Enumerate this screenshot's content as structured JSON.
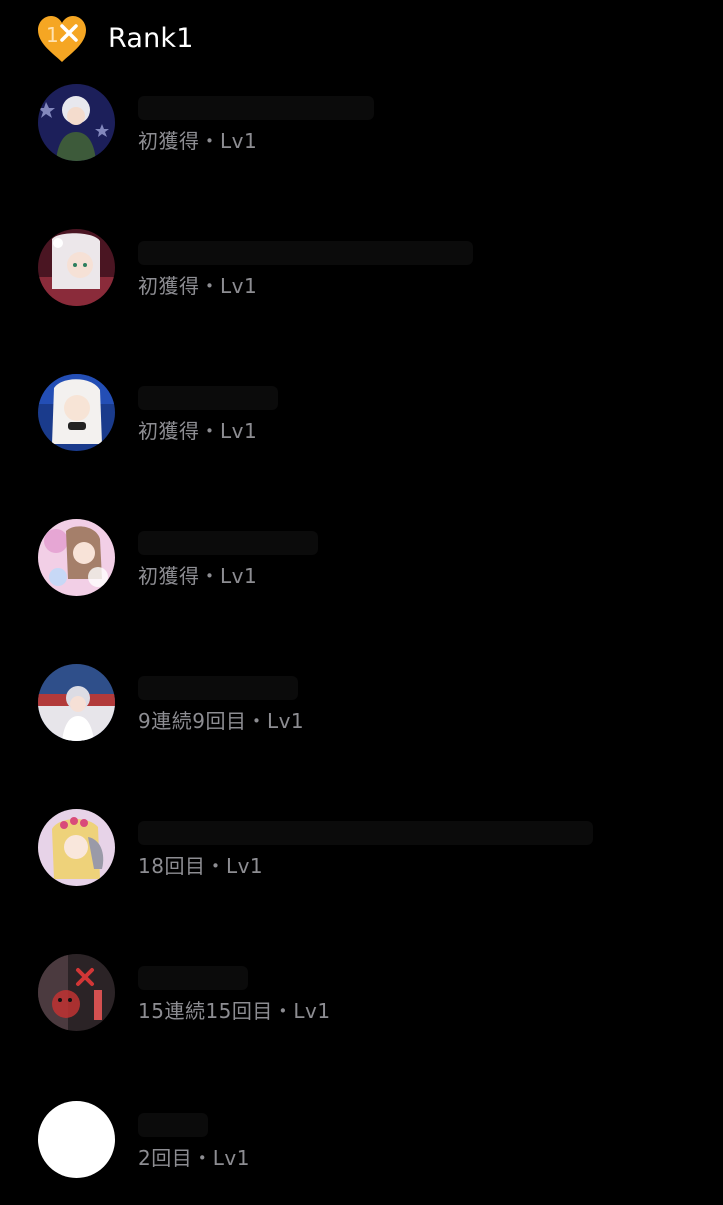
{
  "header": {
    "title": "Rank1",
    "badge_icon": "heart-rank-badge-icon",
    "badge_number": "1",
    "badge_color": "#F5A623"
  },
  "entries": [
    {
      "subtitle": "初獲得・Lv1",
      "avatar_icon": "avatar-image"
    },
    {
      "subtitle": "初獲得・Lv1",
      "avatar_icon": "avatar-image"
    },
    {
      "subtitle": "初獲得・Lv1",
      "avatar_icon": "avatar-image"
    },
    {
      "subtitle": "初獲得・Lv1",
      "avatar_icon": "avatar-image"
    },
    {
      "subtitle": "9連続9回目・Lv1",
      "avatar_icon": "avatar-image"
    },
    {
      "subtitle": "18回目・Lv1",
      "avatar_icon": "avatar-image"
    },
    {
      "subtitle": "15連続15回目・Lv1",
      "avatar_icon": "avatar-image"
    },
    {
      "subtitle": "2回目・Lv1",
      "avatar_icon": "avatar-placeholder"
    }
  ]
}
